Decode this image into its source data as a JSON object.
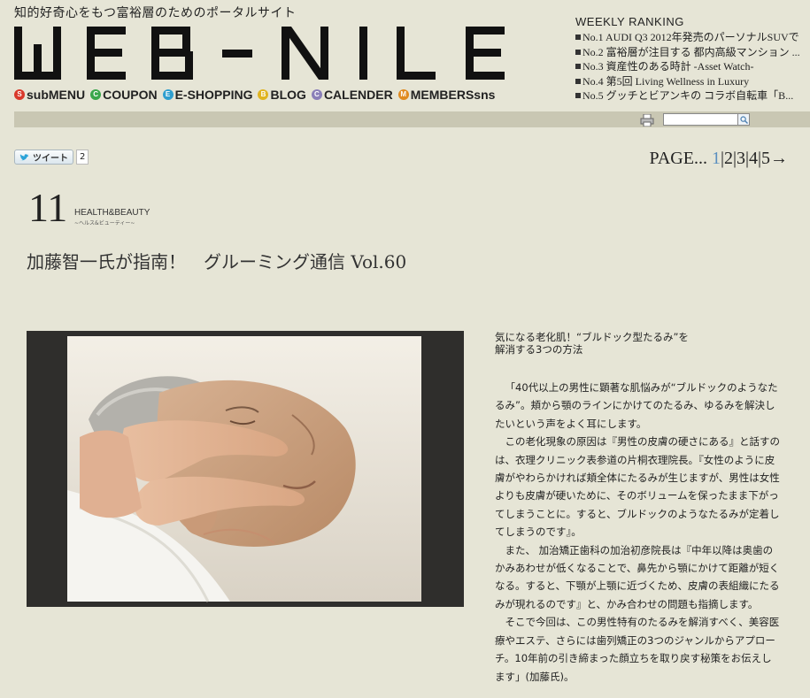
{
  "header": {
    "tagline": "知的好奇心をもつ富裕層のためのポータルサイト",
    "logo_text": "WEB-NILE"
  },
  "nav": [
    {
      "label": "subMENU",
      "color": "#d9392b",
      "glyph": "S"
    },
    {
      "label": "COUPON",
      "color": "#3aa64a",
      "glyph": "C"
    },
    {
      "label": "E-SHOPPING",
      "color": "#2f9fcf",
      "glyph": "E"
    },
    {
      "label": "BLOG",
      "color": "#e0b420",
      "glyph": "B"
    },
    {
      "label": "CALENDER",
      "color": "#8a7fb8",
      "glyph": "C"
    },
    {
      "label": "MEMBERSsns",
      "color": "#e08a1e",
      "glyph": "M"
    }
  ],
  "ranking": {
    "title": "WEEKLY RANKING",
    "items": [
      "No.1 AUDI Q3 2012年発売のパーソナルSUVで",
      "No.2 富裕層が注目する 都内高級マンション ...",
      "No.3 資産性のある時計 -Asset Watch-",
      "No.4 第5回 Living Wellness in Luxury",
      "No.5 グッチとビアンキの コラボ自転車「B..."
    ]
  },
  "toolbar": {
    "print_icon": "printer-icon",
    "search_value": "",
    "search_icon": "search-icon"
  },
  "tweet": {
    "label": "ツイート",
    "count": "2"
  },
  "pager": {
    "prefix": "PAGE...",
    "pages": [
      "1",
      "2",
      "3",
      "4",
      "5"
    ],
    "current": "1",
    "next": "→"
  },
  "category": {
    "number": "11",
    "name": "HEALTH&BEAUTY",
    "sub": "~ヘルス&ビューティー~"
  },
  "headline": "加藤智一氏が指南！　グルーミング通信 Vol.60",
  "article": {
    "title_line1": "気になる老化肌！“ブルドック型たるみ”を",
    "title_line2": "解消する3つの方法",
    "paragraphs": [
      "「40代以上の男性に顕著な肌悩みが“ブルドックのようなたるみ”。頬から顎のラインにかけてのたるみ、ゆるみを解決したいという声をよく耳にします。",
      "この老化現象の原因は『男性の皮膚の硬さにある』と話すのは、衣理クリニック表参道の片桐衣理院長。『女性のように皮膚がやわらかければ頬全体にたるみが生じますが、男性は女性よりも皮膚が硬いために、そのボリュームを保ったまま下がってしまうことに。すると、ブルドックのようなたるみが定着してしまうのです』。",
      "また、 加治矯正歯科の加治初彦院長は『中年以降は奥歯のかみあわせが低くなることで、鼻先から顎にかけて距離が短くなる。すると、下顎が上顎に近づくため、皮膚の表組織にたるみが現れるのです』と、かみ合わせの問題も指摘します。",
      "そこで今回は、この男性特有のたるみを解消すべく、美容医療やエステ、さらには歯列矯正の3つのジャンルからアプローチ。10年前の引き締まった顔立ちを取り戻す秘策をお伝えします」(加藤氏)。"
    ]
  }
}
